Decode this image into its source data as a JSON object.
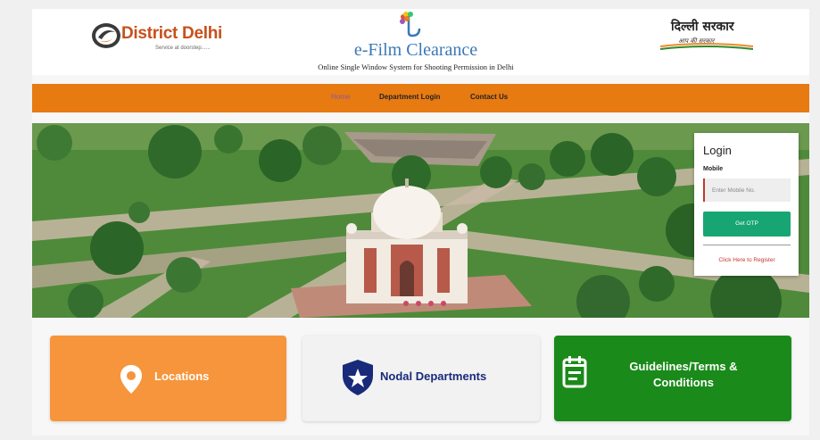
{
  "header": {
    "left_logo": {
      "title": "District Delhi",
      "tagline": "Service at doorstep......"
    },
    "center": {
      "title": "e-Film Clearance",
      "subtitle": "Online Single Window System for Shooting Permission in Delhi"
    },
    "right_logo": {
      "title": "दिल्ली सरकार",
      "tagline": "आप की सरकार"
    }
  },
  "nav": {
    "items": [
      {
        "label": "Home",
        "active": true
      },
      {
        "label": "Department Login",
        "active": false
      },
      {
        "label": "Contact Us",
        "active": false
      }
    ]
  },
  "hero": {
    "slide_count": 4,
    "colors": {
      "grass": "#4f8a3a",
      "path": "#c9b8a6",
      "dome": "#f3eee6",
      "dot": "#c84a6a"
    }
  },
  "login": {
    "title": "Login",
    "mobile_label": "Mobile",
    "mobile_placeholder": "Enter Mobile No.",
    "submit_label": "Get OTP",
    "register_label": "Click Here to Register"
  },
  "cards": [
    {
      "label": "Locations",
      "icon": "location-pin-icon",
      "color": "#f6953b"
    },
    {
      "label": "Nodal Departments",
      "icon": "shield-star-icon",
      "color": "#f2f2f2"
    },
    {
      "label": "Guidelines/Terms & Conditions",
      "icon": "calendar-list-icon",
      "color": "#1a8a1a"
    }
  ],
  "colors": {
    "nav": "#e87a12",
    "accent_green": "#17a673",
    "brand_blue": "#3a78b8"
  }
}
